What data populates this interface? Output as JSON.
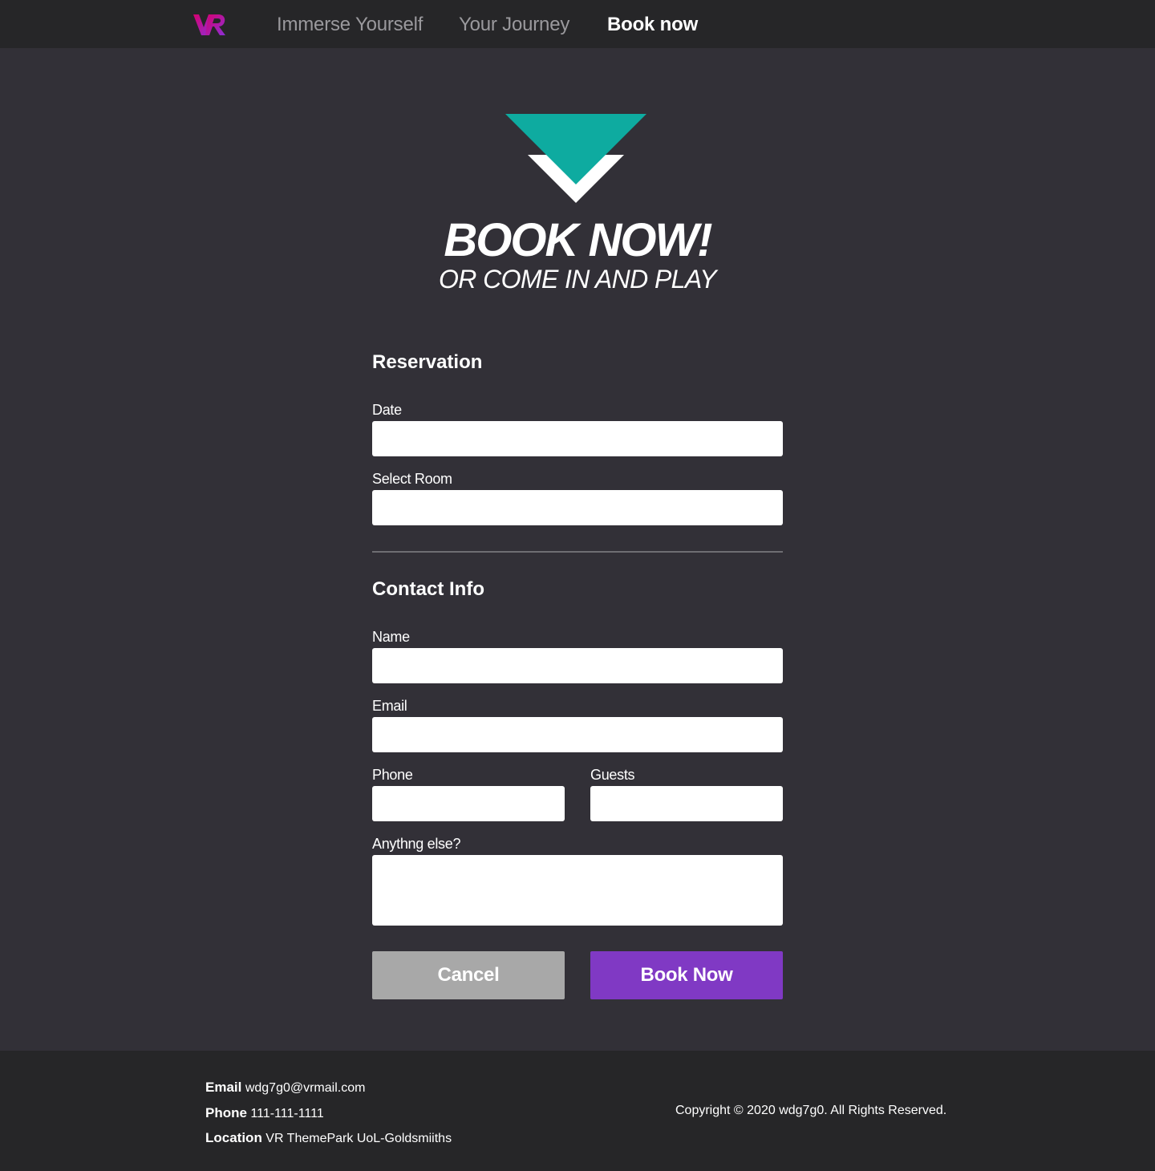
{
  "nav": {
    "logo_text": "VR",
    "links": [
      {
        "label": "Immerse Yourself",
        "active": false
      },
      {
        "label": "Your Journey",
        "active": false
      },
      {
        "label": "Book now",
        "active": true
      }
    ]
  },
  "hero": {
    "title": "BOOK NOW!",
    "subtitle": "OR COME IN AND PLAY",
    "icon": "chevron-down-icon"
  },
  "form": {
    "reservation_heading": "Reservation",
    "date_label": "Date",
    "date_value": "",
    "room_label": "Select Room",
    "room_value": "",
    "contact_heading": "Contact Info",
    "name_label": "Name",
    "name_value": "",
    "email_label": "Email",
    "email_value": "",
    "phone_label": "Phone",
    "phone_value": "",
    "guests_label": "Guests",
    "guests_value": "",
    "notes_label": "Anythng else?",
    "notes_value": "",
    "cancel_label": "Cancel",
    "submit_label": "Book Now"
  },
  "footer": {
    "email_key": "Email",
    "email_value": "wdg7g0@vrmail.com",
    "phone_key": "Phone",
    "phone_value": "111-111-1111",
    "location_key": "Location",
    "location_value": "VR ThemePark UoL-Goldsmiiths",
    "copyright": "Copyright © 2020 wdg7g0. All Rights Reserved."
  },
  "colors": {
    "page_bg": "#323037",
    "nav_bg": "#262628",
    "accent_teal": "#0eaba0",
    "accent_purple": "#8039c4",
    "logo_gradient_start": "#d6006f",
    "logo_gradient_end": "#8d2fd6",
    "cancel_gray": "#a8a8a8"
  }
}
